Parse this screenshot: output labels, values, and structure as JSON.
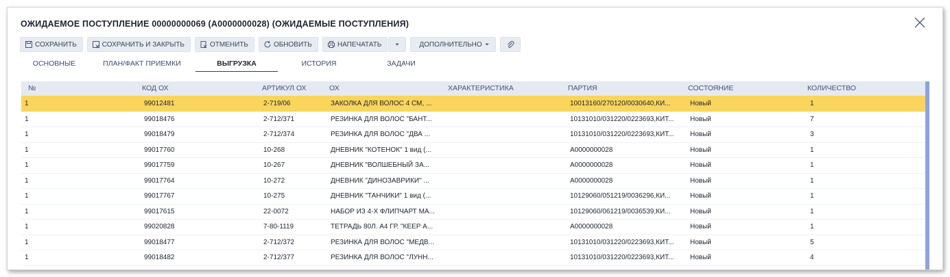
{
  "window": {
    "title": "ОЖИДАЕМОЕ ПОСТУПЛЕНИЕ 00000000069 (А0000000028) (ОЖИДАЕМЫЕ ПОСТУПЛЕНИЯ)"
  },
  "toolbar": {
    "save": "СОХРАНИТЬ",
    "save_close": "СОХРАНИТЬ И ЗАКРЫТЬ",
    "cancel": "ОТМЕНИТЬ",
    "refresh": "ОБНОВИТЬ",
    "print": "НАПЕЧАТАТЬ",
    "more": "ДОПОЛНИТЕЛЬНО"
  },
  "tabs": [
    "ОСНОВНЫЕ",
    "ПЛАН/ФАКТ ПРИЕМКИ",
    "ВЫГРУЗКА",
    "ИСТОРИЯ",
    "ЗАДАЧИ"
  ],
  "table": {
    "columns": [
      "№",
      "КОД ОХ",
      "АРТИКУЛ ОХ",
      "ОХ",
      "ХАРАКТЕРИСТИКА",
      "ПАРТИЯ",
      "СОСТОЯНИЕ",
      "КОЛИЧЕСТВО"
    ],
    "rows": [
      {
        "n": "1",
        "code": "99012481",
        "art": "2-719/06",
        "name": "ЗАКОЛКА ДЛЯ ВОЛОС  4 СМ, ...",
        "char": "",
        "batch": "10013160/270120/0030640,КИ...",
        "state": "Новый",
        "qty": "1"
      },
      {
        "n": "1",
        "code": "99018476",
        "art": "2-712/371",
        "name": "РЕЗИНКА ДЛЯ ВОЛОС \"БАНТ...",
        "char": "",
        "batch": "10131010/031220/0223693,КИТ...",
        "state": "Новый",
        "qty": "7"
      },
      {
        "n": "1",
        "code": "99018479",
        "art": "2-712/374",
        "name": "РЕЗИНКА ДЛЯ ВОЛОС \"ДВА ...",
        "char": "",
        "batch": "10131010/031220/0223693,КИТ...",
        "state": "Новый",
        "qty": "3"
      },
      {
        "n": "1",
        "code": "99017760",
        "art": "10-268",
        "name": "ДНЕВНИК  \"КОТЕНОК\" 1 вид (...",
        "char": "",
        "batch": "А0000000028",
        "state": "Новый",
        "qty": "1"
      },
      {
        "n": "1",
        "code": "99017759",
        "art": "10-267",
        "name": "ДНЕВНИК  \"ВОЛШЕБНЫЙ ЗА...",
        "char": "",
        "batch": "А0000000028",
        "state": "Новый",
        "qty": "1"
      },
      {
        "n": "1",
        "code": "99017764",
        "art": "10-272",
        "name": "ДНЕВНИК  \"ДИНОЗАВРИКИ\" ...",
        "char": "",
        "batch": "А0000000028",
        "state": "Новый",
        "qty": "1"
      },
      {
        "n": "1",
        "code": "99017767",
        "art": "10-275",
        "name": "ДНЕВНИК  \"ТАНЧИКИ\" 1 вид (...",
        "char": "",
        "batch": "10129060/051219/0036296,КИ...",
        "state": "Новый",
        "qty": "1"
      },
      {
        "n": "1",
        "code": "99017615",
        "art": "22-0072",
        "name": "НАБОР ИЗ 4-Х ФЛИПЧАРТ МА...",
        "char": "",
        "batch": "10129060/061219/0036539,КИ...",
        "state": "Новый",
        "qty": "1"
      },
      {
        "n": "1",
        "code": "99020828",
        "art": "7-80-1119",
        "name": "ТЕТРАДЬ 80Л. А4 ГР. \"КЕЕР А...",
        "char": "",
        "batch": "А0000000028",
        "state": "Новый",
        "qty": "1"
      },
      {
        "n": "1",
        "code": "99018477",
        "art": "2-712/372",
        "name": "РЕЗИНКА ДЛЯ ВОЛОС \"МЕДВ...",
        "char": "",
        "batch": "10131010/031220/0223693,КИТ...",
        "state": "Новый",
        "qty": "5"
      },
      {
        "n": "1",
        "code": "99018482",
        "art": "2-712/377",
        "name": "РЕЗИНКА ДЛЯ ВОЛОС \"ЛУНН...",
        "char": "",
        "batch": "10131010/031220/0223693,КИТ...",
        "state": "Новый",
        "qty": "4"
      }
    ]
  },
  "colors": {
    "selected_row": "#f9d55c",
    "header_bg": "#e4e9f2",
    "button_bg": "#e7ebf2",
    "scrollbar": "#8fa2e0"
  }
}
